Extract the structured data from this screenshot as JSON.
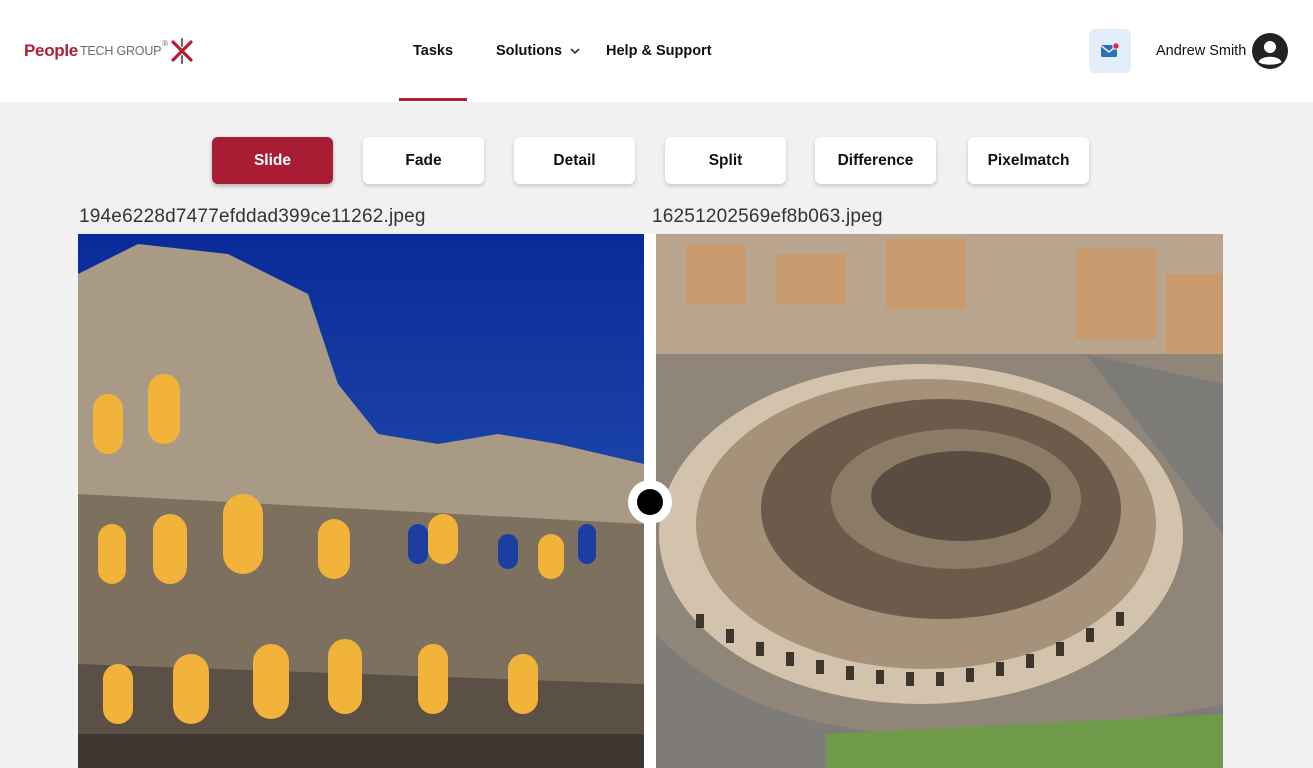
{
  "header": {
    "logo": {
      "word1": "People",
      "word2": "TECH GROUP",
      "mark": "®"
    },
    "nav": {
      "tasks": "Tasks",
      "solutions": "Solutions",
      "help": "Help & Support"
    },
    "mail_icon": "mail-notification-icon",
    "user_name": "Andrew Smith",
    "avatar_icon": "user-circle-icon"
  },
  "modes": {
    "items": [
      "Slide",
      "Fade",
      "Detail",
      "Split",
      "Difference",
      "Pixelmatch"
    ],
    "active": "Slide"
  },
  "compare": {
    "left_file": "194e6228d7477efddad399ce11262.jpeg",
    "right_file": "16251202569ef8b063.jpeg",
    "slider_position": 0.5
  },
  "colors": {
    "brand": "#a81d33",
    "mail_bg": "#e4eef8",
    "background": "#f1f1f1"
  }
}
